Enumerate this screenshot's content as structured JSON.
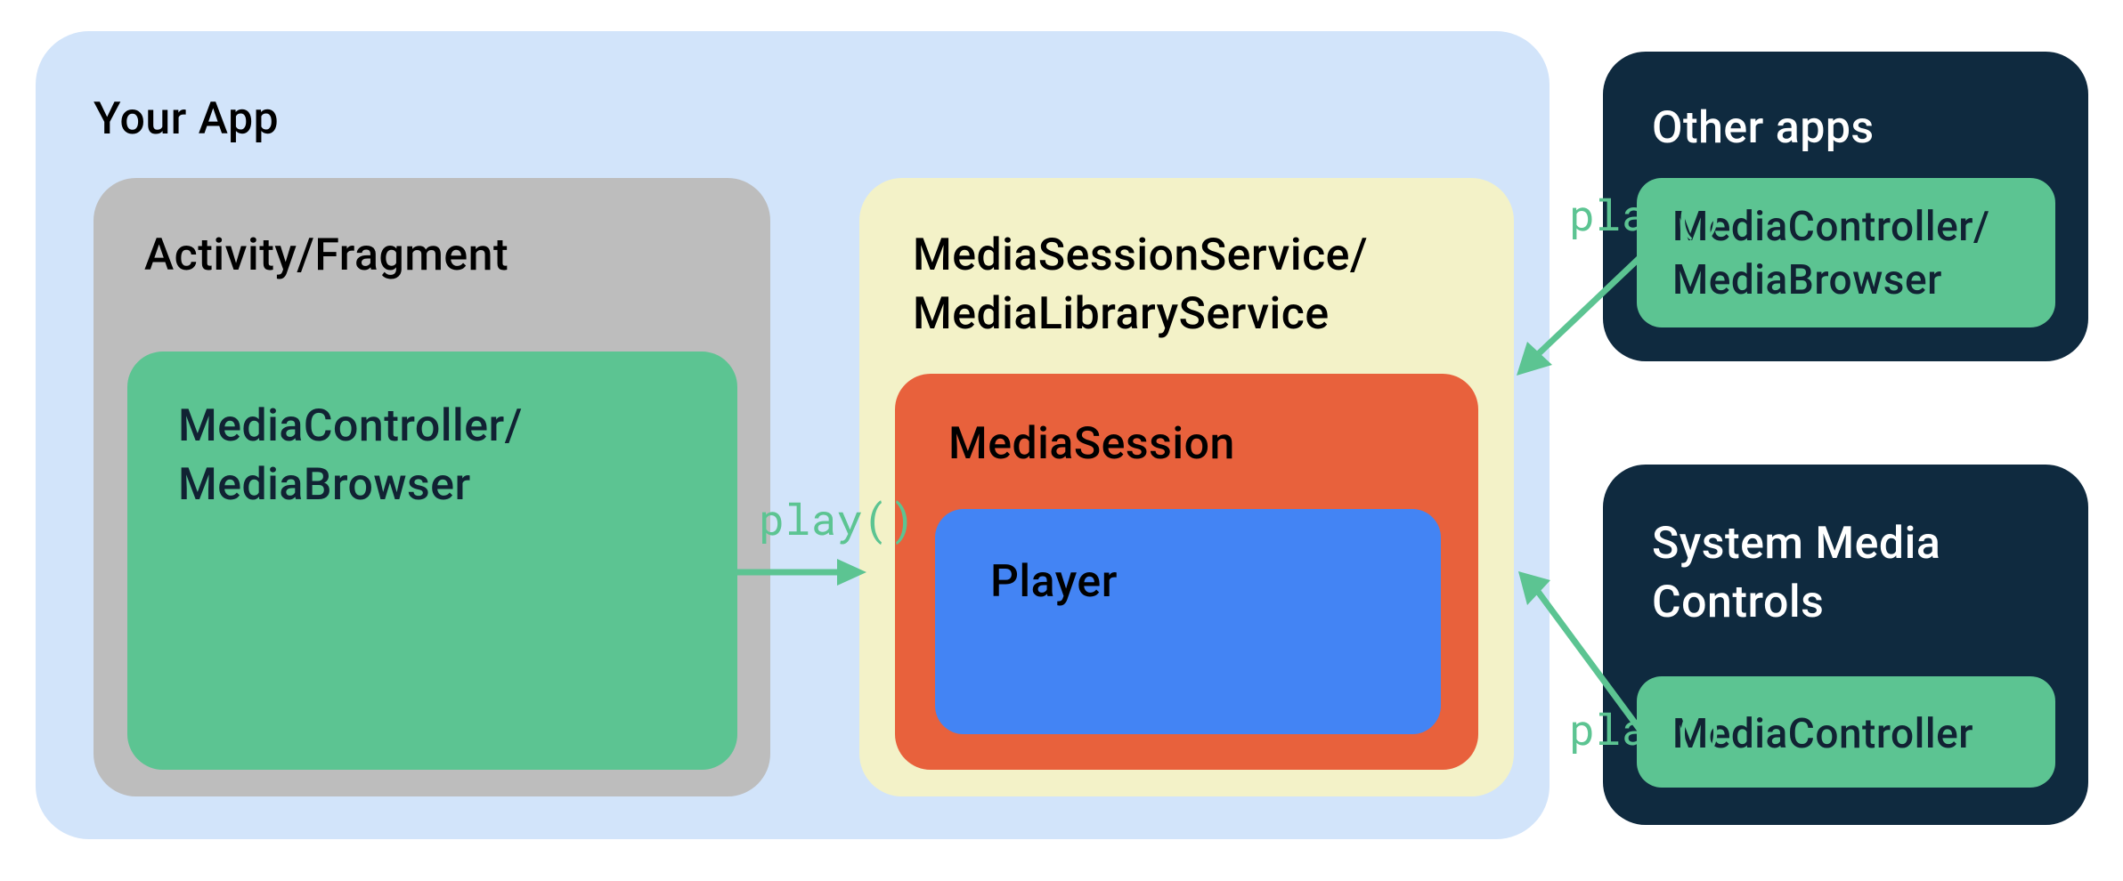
{
  "diagram": {
    "your_app": {
      "title": "Your App",
      "activity": {
        "title": "Activity/Fragment",
        "controller_line1": "MediaController/",
        "controller_line2": "MediaBrowser"
      },
      "service": {
        "title_line1": "MediaSessionService/",
        "title_line2": "MediaLibraryService",
        "mediasession": {
          "title": "MediaSession",
          "player": "Player"
        }
      }
    },
    "other_apps": {
      "title": "Other apps",
      "controller_line1": "MediaController/",
      "controller_line2": "MediaBrowser"
    },
    "system_controls": {
      "title_line1": "System Media",
      "title_line2": "Controls",
      "controller": "MediaController"
    },
    "arrows": {
      "a1_label": "play()",
      "a2_label": "play()",
      "a3_label": "play()"
    }
  }
}
